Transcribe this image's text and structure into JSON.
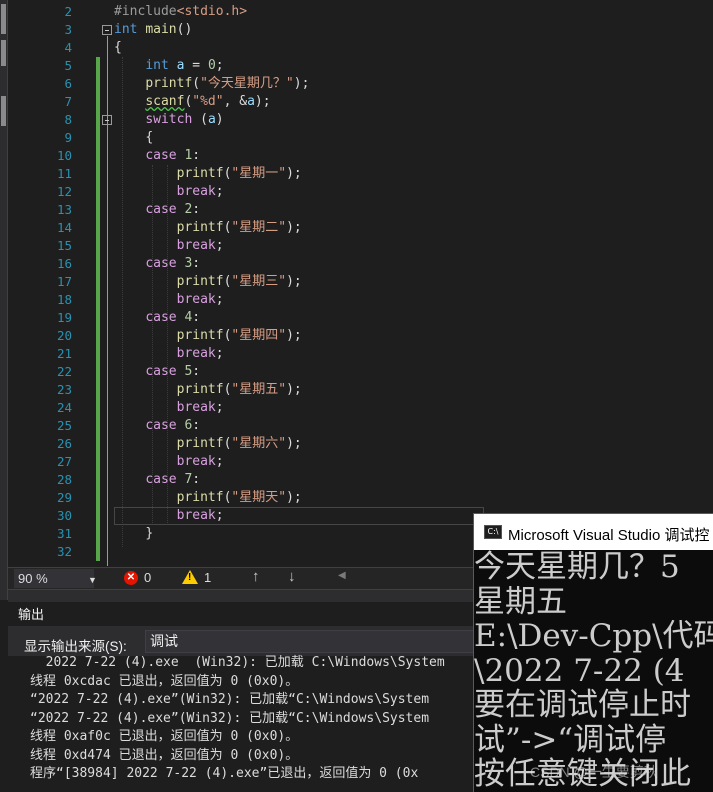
{
  "editor": {
    "line_numbers": [
      "2",
      "3",
      "4",
      "5",
      "6",
      "7",
      "8",
      "9",
      "10",
      "11",
      "12",
      "13",
      "14",
      "15",
      "16",
      "17",
      "18",
      "19",
      "20",
      "21",
      "22",
      "23",
      "24",
      "25",
      "26",
      "27",
      "28",
      "29",
      "30",
      "31",
      "32"
    ],
    "lines": [
      {
        "indent": "",
        "parts": [
          {
            "t": "#include",
            "c": "pp"
          },
          {
            "t": "<stdio.h>",
            "c": "inc"
          }
        ]
      },
      {
        "indent": "",
        "parts": [
          {
            "t": "int",
            "c": "kw"
          },
          {
            "t": " "
          },
          {
            "t": "main",
            "c": "fn"
          },
          {
            "t": "()"
          }
        ]
      },
      {
        "indent": "",
        "parts": [
          {
            "t": "{"
          }
        ]
      },
      {
        "indent": "    ",
        "parts": [
          {
            "t": "int",
            "c": "kw"
          },
          {
            "t": " "
          },
          {
            "t": "a",
            "c": "var"
          },
          {
            "t": " = "
          },
          {
            "t": "0",
            "c": "num"
          },
          {
            "t": ";"
          }
        ]
      },
      {
        "indent": "    ",
        "parts": [
          {
            "t": "printf",
            "c": "fn"
          },
          {
            "t": "("
          },
          {
            "t": "\"今天星期几？\"",
            "c": "str"
          },
          {
            "t": ");"
          }
        ]
      },
      {
        "indent": "    ",
        "parts": [
          {
            "t": "scanf",
            "c": "fn sq"
          },
          {
            "t": "("
          },
          {
            "t": "\"%d\"",
            "c": "str"
          },
          {
            "t": ", &"
          },
          {
            "t": "a",
            "c": "var"
          },
          {
            "t": ");"
          }
        ]
      },
      {
        "indent": "    ",
        "parts": [
          {
            "t": "switch",
            "c": "kw2"
          },
          {
            "t": " ("
          },
          {
            "t": "a",
            "c": "var"
          },
          {
            "t": ")"
          }
        ]
      },
      {
        "indent": "    ",
        "parts": [
          {
            "t": "{"
          }
        ]
      },
      {
        "indent": "    ",
        "parts": [
          {
            "t": "case",
            "c": "kw2"
          },
          {
            "t": " "
          },
          {
            "t": "1",
            "c": "num"
          },
          {
            "t": ":"
          }
        ]
      },
      {
        "indent": "        ",
        "parts": [
          {
            "t": "printf",
            "c": "fn"
          },
          {
            "t": "("
          },
          {
            "t": "\"星期一\"",
            "c": "str"
          },
          {
            "t": ");"
          }
        ]
      },
      {
        "indent": "        ",
        "parts": [
          {
            "t": "break",
            "c": "kw2"
          },
          {
            "t": ";"
          }
        ]
      },
      {
        "indent": "    ",
        "parts": [
          {
            "t": "case",
            "c": "kw2"
          },
          {
            "t": " "
          },
          {
            "t": "2",
            "c": "num"
          },
          {
            "t": ":"
          }
        ]
      },
      {
        "indent": "        ",
        "parts": [
          {
            "t": "printf",
            "c": "fn"
          },
          {
            "t": "("
          },
          {
            "t": "\"星期二\"",
            "c": "str"
          },
          {
            "t": ");"
          }
        ]
      },
      {
        "indent": "        ",
        "parts": [
          {
            "t": "break",
            "c": "kw2"
          },
          {
            "t": ";"
          }
        ]
      },
      {
        "indent": "    ",
        "parts": [
          {
            "t": "case",
            "c": "kw2"
          },
          {
            "t": " "
          },
          {
            "t": "3",
            "c": "num"
          },
          {
            "t": ":"
          }
        ]
      },
      {
        "indent": "        ",
        "parts": [
          {
            "t": "printf",
            "c": "fn"
          },
          {
            "t": "("
          },
          {
            "t": "\"星期三\"",
            "c": "str"
          },
          {
            "t": ");"
          }
        ]
      },
      {
        "indent": "        ",
        "parts": [
          {
            "t": "break",
            "c": "kw2"
          },
          {
            "t": ";"
          }
        ]
      },
      {
        "indent": "    ",
        "parts": [
          {
            "t": "case",
            "c": "kw2"
          },
          {
            "t": " "
          },
          {
            "t": "4",
            "c": "num"
          },
          {
            "t": ":"
          }
        ]
      },
      {
        "indent": "        ",
        "parts": [
          {
            "t": "printf",
            "c": "fn"
          },
          {
            "t": "("
          },
          {
            "t": "\"星期四\"",
            "c": "str"
          },
          {
            "t": ");"
          }
        ]
      },
      {
        "indent": "        ",
        "parts": [
          {
            "t": "break",
            "c": "kw2"
          },
          {
            "t": ";"
          }
        ]
      },
      {
        "indent": "    ",
        "parts": [
          {
            "t": "case",
            "c": "kw2"
          },
          {
            "t": " "
          },
          {
            "t": "5",
            "c": "num"
          },
          {
            "t": ":"
          }
        ]
      },
      {
        "indent": "        ",
        "parts": [
          {
            "t": "printf",
            "c": "fn"
          },
          {
            "t": "("
          },
          {
            "t": "\"星期五\"",
            "c": "str"
          },
          {
            "t": ");"
          }
        ]
      },
      {
        "indent": "        ",
        "parts": [
          {
            "t": "break",
            "c": "kw2"
          },
          {
            "t": ";"
          }
        ]
      },
      {
        "indent": "    ",
        "parts": [
          {
            "t": "case",
            "c": "kw2"
          },
          {
            "t": " "
          },
          {
            "t": "6",
            "c": "num"
          },
          {
            "t": ":"
          }
        ]
      },
      {
        "indent": "        ",
        "parts": [
          {
            "t": "printf",
            "c": "fn"
          },
          {
            "t": "("
          },
          {
            "t": "\"星期六\"",
            "c": "str"
          },
          {
            "t": ");"
          }
        ]
      },
      {
        "indent": "        ",
        "parts": [
          {
            "t": "break",
            "c": "kw2"
          },
          {
            "t": ";"
          }
        ]
      },
      {
        "indent": "    ",
        "parts": [
          {
            "t": "case",
            "c": "kw2"
          },
          {
            "t": " "
          },
          {
            "t": "7",
            "c": "num"
          },
          {
            "t": ":"
          }
        ]
      },
      {
        "indent": "        ",
        "parts": [
          {
            "t": "printf",
            "c": "fn"
          },
          {
            "t": "("
          },
          {
            "t": "\"星期天\"",
            "c": "str"
          },
          {
            "t": ");"
          }
        ]
      },
      {
        "indent": "        ",
        "parts": [
          {
            "t": "break",
            "c": "kw2"
          },
          {
            "t": ";"
          }
        ]
      },
      {
        "indent": "    ",
        "parts": [
          {
            "t": "}"
          }
        ]
      },
      {
        "indent": "",
        "parts": []
      }
    ]
  },
  "status": {
    "zoom": "90 %",
    "errors": "0",
    "warnings": "1",
    "error_icon": "error-icon",
    "warning_icon": "warning-icon"
  },
  "output": {
    "title": "输出",
    "source_label": "显示输出来源(S):",
    "source_value": "调试",
    "lines": [
      "  2022 7-22 (4).exe  (Win32): 已加载 C:\\Windows\\System",
      "线程 0xcdac 已退出，返回值为 0 (0x0)。",
      "“2022 7-22 (4).exe”(Win32): 已加载“C:\\Windows\\System",
      "“2022 7-22 (4).exe”(Win32): 已加载“C:\\Windows\\System",
      "线程 0xaf0c 已退出，返回值为 0 (0x0)。",
      "线程 0xd474 已退出，返回值为 0 (0x0)。",
      "程序“[38984] 2022 7-22 (4).exe”已退出，返回值为 0 (0x"
    ]
  },
  "console": {
    "title": "Microsoft Visual Studio 调试控",
    "lines": [
      "今天星期几？5",
      "星期五",
      "E:\\Dev-Cpp\\代码",
      "\\2022 7-22 (4",
      "要在调试停止时",
      "试”->“调试停",
      "按任意键关闭此"
    ]
  },
  "watermark": "CSDN @一生要剪秋"
}
